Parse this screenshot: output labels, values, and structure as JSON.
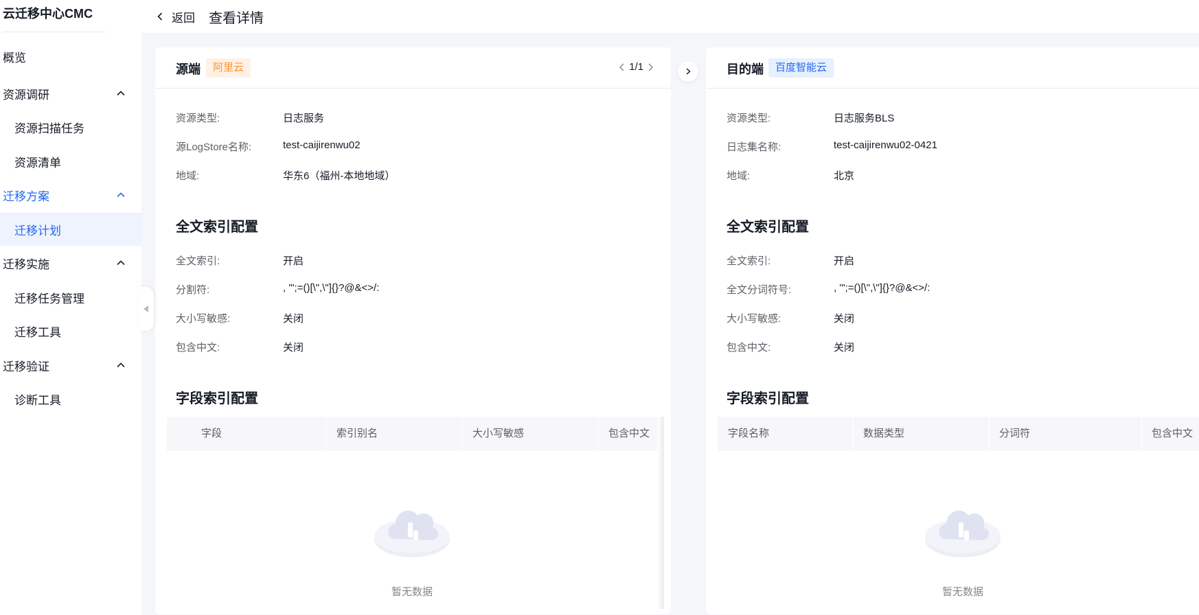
{
  "app": {
    "title": "云迁移中心CMC"
  },
  "sidebar": {
    "items": [
      {
        "label": "概览"
      },
      {
        "label": "资源调研"
      },
      {
        "label": "资源扫描任务"
      },
      {
        "label": "资源清单"
      },
      {
        "label": "迁移方案"
      },
      {
        "label": "迁移计划"
      },
      {
        "label": "迁移实施"
      },
      {
        "label": "迁移任务管理"
      },
      {
        "label": "迁移工具"
      },
      {
        "label": "迁移验证"
      },
      {
        "label": "诊断工具"
      }
    ],
    "active_group": "迁移方案",
    "selected_item": "迁移计划"
  },
  "header": {
    "back_label": "返回",
    "title": "查看详情"
  },
  "source": {
    "title": "源端",
    "tag": "阿里云",
    "pager": "1/1",
    "basic": [
      {
        "k": "资源类型:",
        "v": "日志服务"
      },
      {
        "k": "源LogStore名称:",
        "v": "test-caijirenwu02"
      },
      {
        "k": "地域:",
        "v": "华东6（福州-本地地域）"
      }
    ],
    "fulltext_title": "全文索引配置",
    "fulltext": [
      {
        "k": "全文索引:",
        "v": "开启"
      },
      {
        "k": "分割符:",
        "v": ", '\";=()[\\\",\\\"]{}?@&<>/:"
      },
      {
        "k": "大小写敏感:",
        "v": "关闭"
      },
      {
        "k": "包含中文:",
        "v": "关闭"
      }
    ],
    "field_title": "字段索引配置",
    "columns": [
      "字段",
      "索引别名",
      "大小写敏感",
      "包含中文"
    ],
    "empty_text": "暂无数据"
  },
  "target": {
    "title": "目的端",
    "tag": "百度智能云",
    "basic": [
      {
        "k": "资源类型:",
        "v": "日志服务BLS"
      },
      {
        "k": "日志集名称:",
        "v": "test-caijirenwu02-0421"
      },
      {
        "k": "地域:",
        "v": "北京"
      }
    ],
    "fulltext_title": "全文索引配置",
    "fulltext": [
      {
        "k": "全文索引:",
        "v": "开启"
      },
      {
        "k": "全文分词符号:",
        "v": ", '\";=()[\\\",\\\"]{}?@&<>/:"
      },
      {
        "k": "大小写敏感:",
        "v": "关闭"
      },
      {
        "k": "包含中文:",
        "v": "关闭"
      }
    ],
    "field_title": "字段索引配置",
    "columns": [
      "字段名称",
      "数据类型",
      "分词符",
      "包含中文"
    ],
    "empty_text": "暂无数据"
  },
  "colors": {
    "accent": "#2468f2",
    "orange": "#ff9326",
    "selected_bg": "#eef3fe"
  }
}
